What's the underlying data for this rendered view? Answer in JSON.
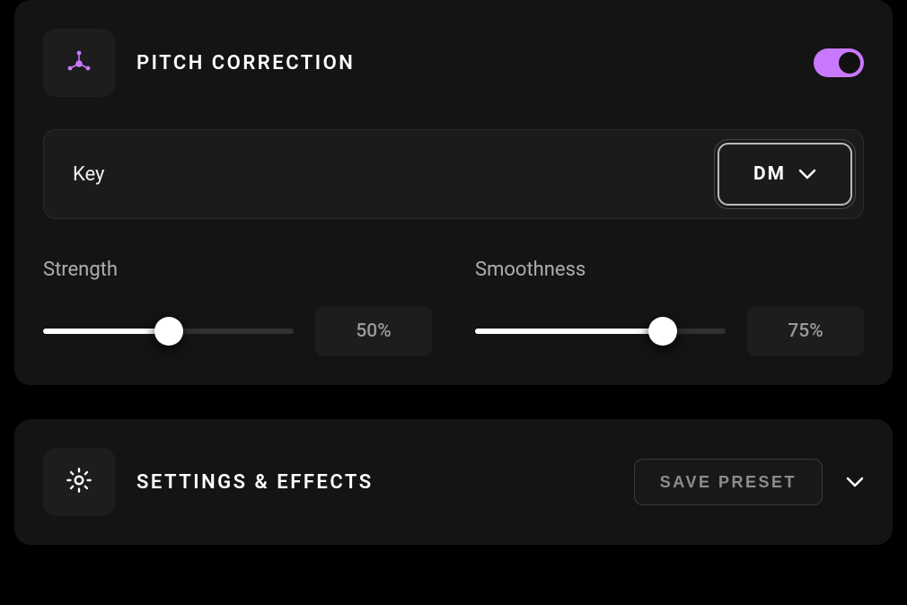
{
  "pitch": {
    "title": "PITCH CORRECTION",
    "enabled": true,
    "key": {
      "label": "Key",
      "selected": "DM"
    },
    "sliders": {
      "strength": {
        "label": "Strength",
        "value": 50,
        "display": "50%"
      },
      "smoothness": {
        "label": "Smoothness",
        "value": 75,
        "display": "75%"
      }
    }
  },
  "settings": {
    "title": "SETTINGS & EFFECTS",
    "save_preset_label": "SAVE PRESET"
  },
  "colors": {
    "accent": "#c879ff"
  }
}
